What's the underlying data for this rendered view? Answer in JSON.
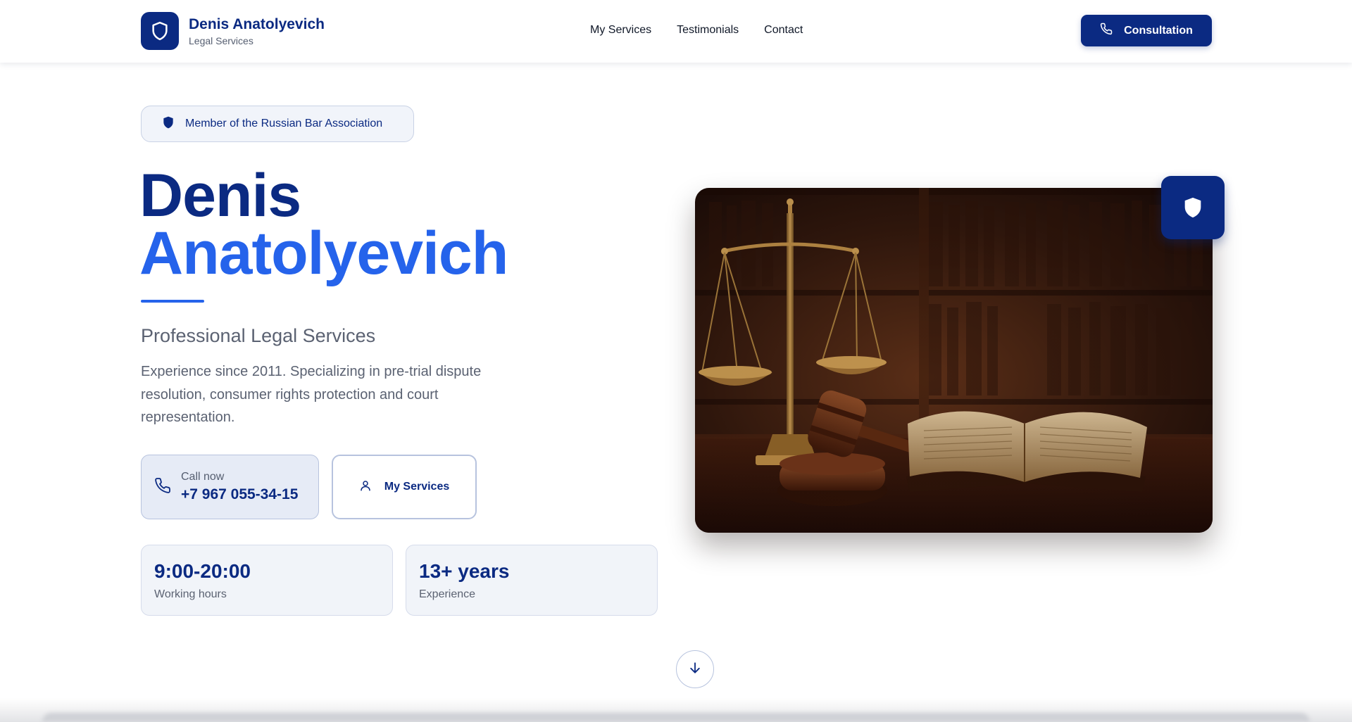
{
  "brand": {
    "name": "Denis Anatolyevich",
    "subtitle": "Legal Services",
    "logo_icon": "shield-icon"
  },
  "nav": {
    "items": [
      {
        "label": "My Services"
      },
      {
        "label": "Testimonials"
      },
      {
        "label": "Contact"
      }
    ]
  },
  "header_cta": {
    "label": "Consultation",
    "icon": "phone-icon"
  },
  "hero": {
    "badge": "Member of the Russian Bar Association",
    "first_name": "Denis",
    "last_name": "Anatolyevich",
    "subtitle": "Professional Legal Services",
    "description": "Experience since 2011. Specializing in pre-trial dispute resolution, consumer rights protection and court representation.",
    "call": {
      "label": "Call now",
      "number": "+7 967 055-34-15",
      "icon": "phone-icon"
    },
    "services_button": {
      "label": "My Services",
      "icon": "user-icon"
    },
    "stats": [
      {
        "value": "9:00-20:00",
        "label": "Working hours"
      },
      {
        "value": "13+ years",
        "label": "Experience"
      }
    ],
    "image_icon": "shield-icon",
    "scroll_icon": "arrow-down-icon"
  },
  "colors": {
    "primary": "#0b2a82",
    "accent": "#2563eb",
    "muted_text": "#5b6272"
  }
}
